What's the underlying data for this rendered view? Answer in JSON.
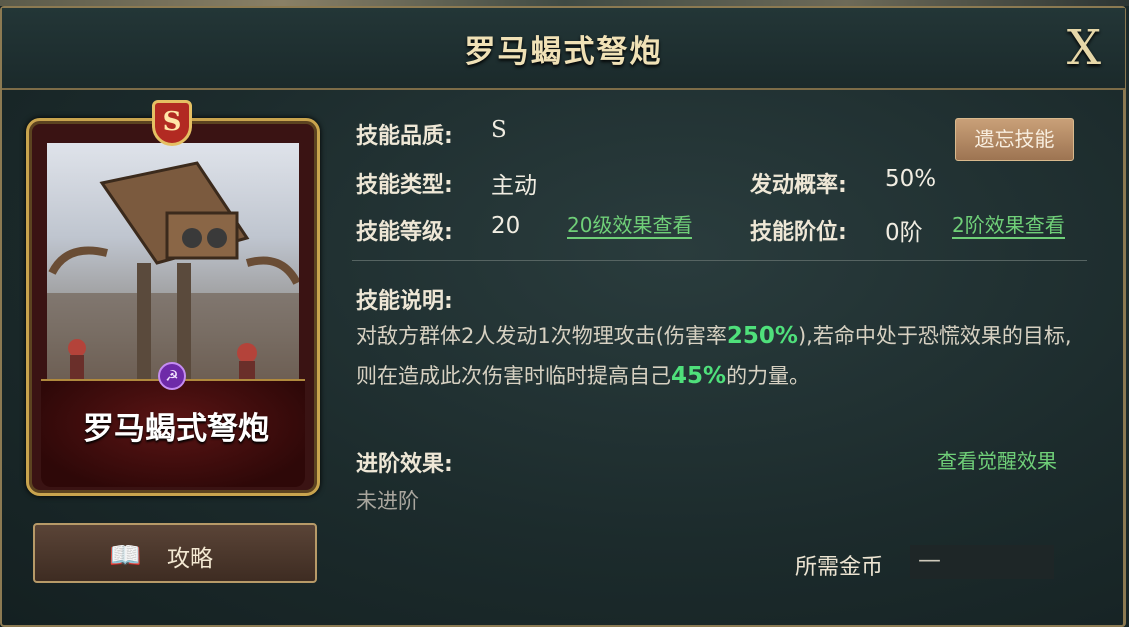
{
  "header": {
    "title": "罗马蝎式弩炮",
    "close_label": "X"
  },
  "card": {
    "grade": "S",
    "name": "罗马蝎式弩炮"
  },
  "guide_button": {
    "label": "攻略",
    "icon": "book-icon"
  },
  "info": {
    "quality_label": "技能品质:",
    "quality_value": "S",
    "type_label": "技能类型:",
    "type_value": "主动",
    "level_label": "技能等级:",
    "level_value": "20",
    "level_link": "20级效果查看",
    "trigger_label": "发动概率:",
    "trigger_value": "50%",
    "rank_label": "技能阶位:",
    "rank_value": "0阶",
    "rank_link": "2阶效果查看",
    "forget_button": "遗忘技能"
  },
  "description": {
    "label": "技能说明:",
    "part1": "对敌方群体2人发动1次物理攻击(伤害率",
    "highlight1": "250%",
    "part2": "),若命中处于恐慌效果的目标,则在造成此次伤害时临时提高自己",
    "highlight2": "45%",
    "part3": "的力量。"
  },
  "advance": {
    "label": "进阶效果:",
    "status": "未进阶",
    "awaken_link": "查看觉醒效果"
  },
  "cost": {
    "label": "所需金币",
    "value": "—"
  },
  "colors": {
    "highlight_green": "#4fe07b",
    "link_green": "#6fcf78",
    "gold_border": "#c9a44e"
  }
}
